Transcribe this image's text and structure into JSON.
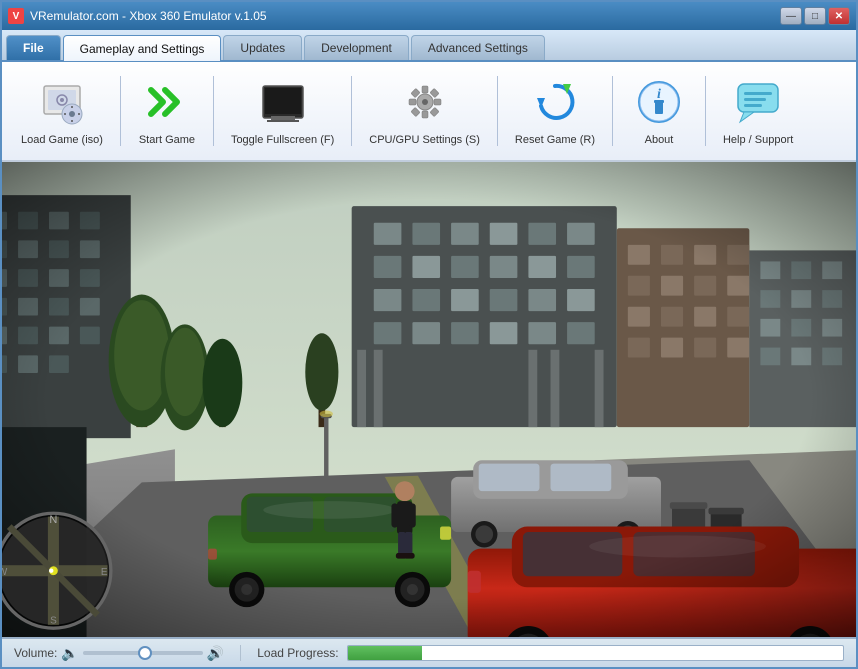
{
  "window": {
    "title": "VRemulator.com - Xbox 360 Emulator v.1.05",
    "icon_label": "V"
  },
  "title_buttons": {
    "minimize": "—",
    "maximize": "□",
    "close": "✕"
  },
  "tabs": [
    {
      "id": "file",
      "label": "File",
      "active": false,
      "is_file": true
    },
    {
      "id": "gameplay",
      "label": "Gameplay and Settings",
      "active": true,
      "is_file": false
    },
    {
      "id": "updates",
      "label": "Updates",
      "active": false,
      "is_file": false
    },
    {
      "id": "development",
      "label": "Development",
      "active": false,
      "is_file": false
    },
    {
      "id": "advanced",
      "label": "Advanced Settings",
      "active": false,
      "is_file": false
    }
  ],
  "toolbar": {
    "buttons": [
      {
        "id": "load-game",
        "label": "Load Game (iso)",
        "icon_type": "load"
      },
      {
        "id": "start-game",
        "label": "Start Game",
        "icon_type": "start"
      },
      {
        "id": "toggle-fullscreen",
        "label": "Toggle Fullscreen (F)",
        "icon_type": "fullscreen"
      },
      {
        "id": "cpu-gpu-settings",
        "label": "CPU/GPU Settings (S)",
        "icon_type": "settings"
      },
      {
        "id": "reset-game",
        "label": "Reset Game (R)",
        "icon_type": "reset"
      },
      {
        "id": "about",
        "label": "About",
        "icon_type": "info"
      },
      {
        "id": "help-support",
        "label": "Help / Support",
        "icon_type": "help"
      }
    ]
  },
  "status_bar": {
    "volume_label": "Volume:",
    "load_progress_label": "Load Progress:",
    "volume_value": 50,
    "progress_value": 15
  }
}
